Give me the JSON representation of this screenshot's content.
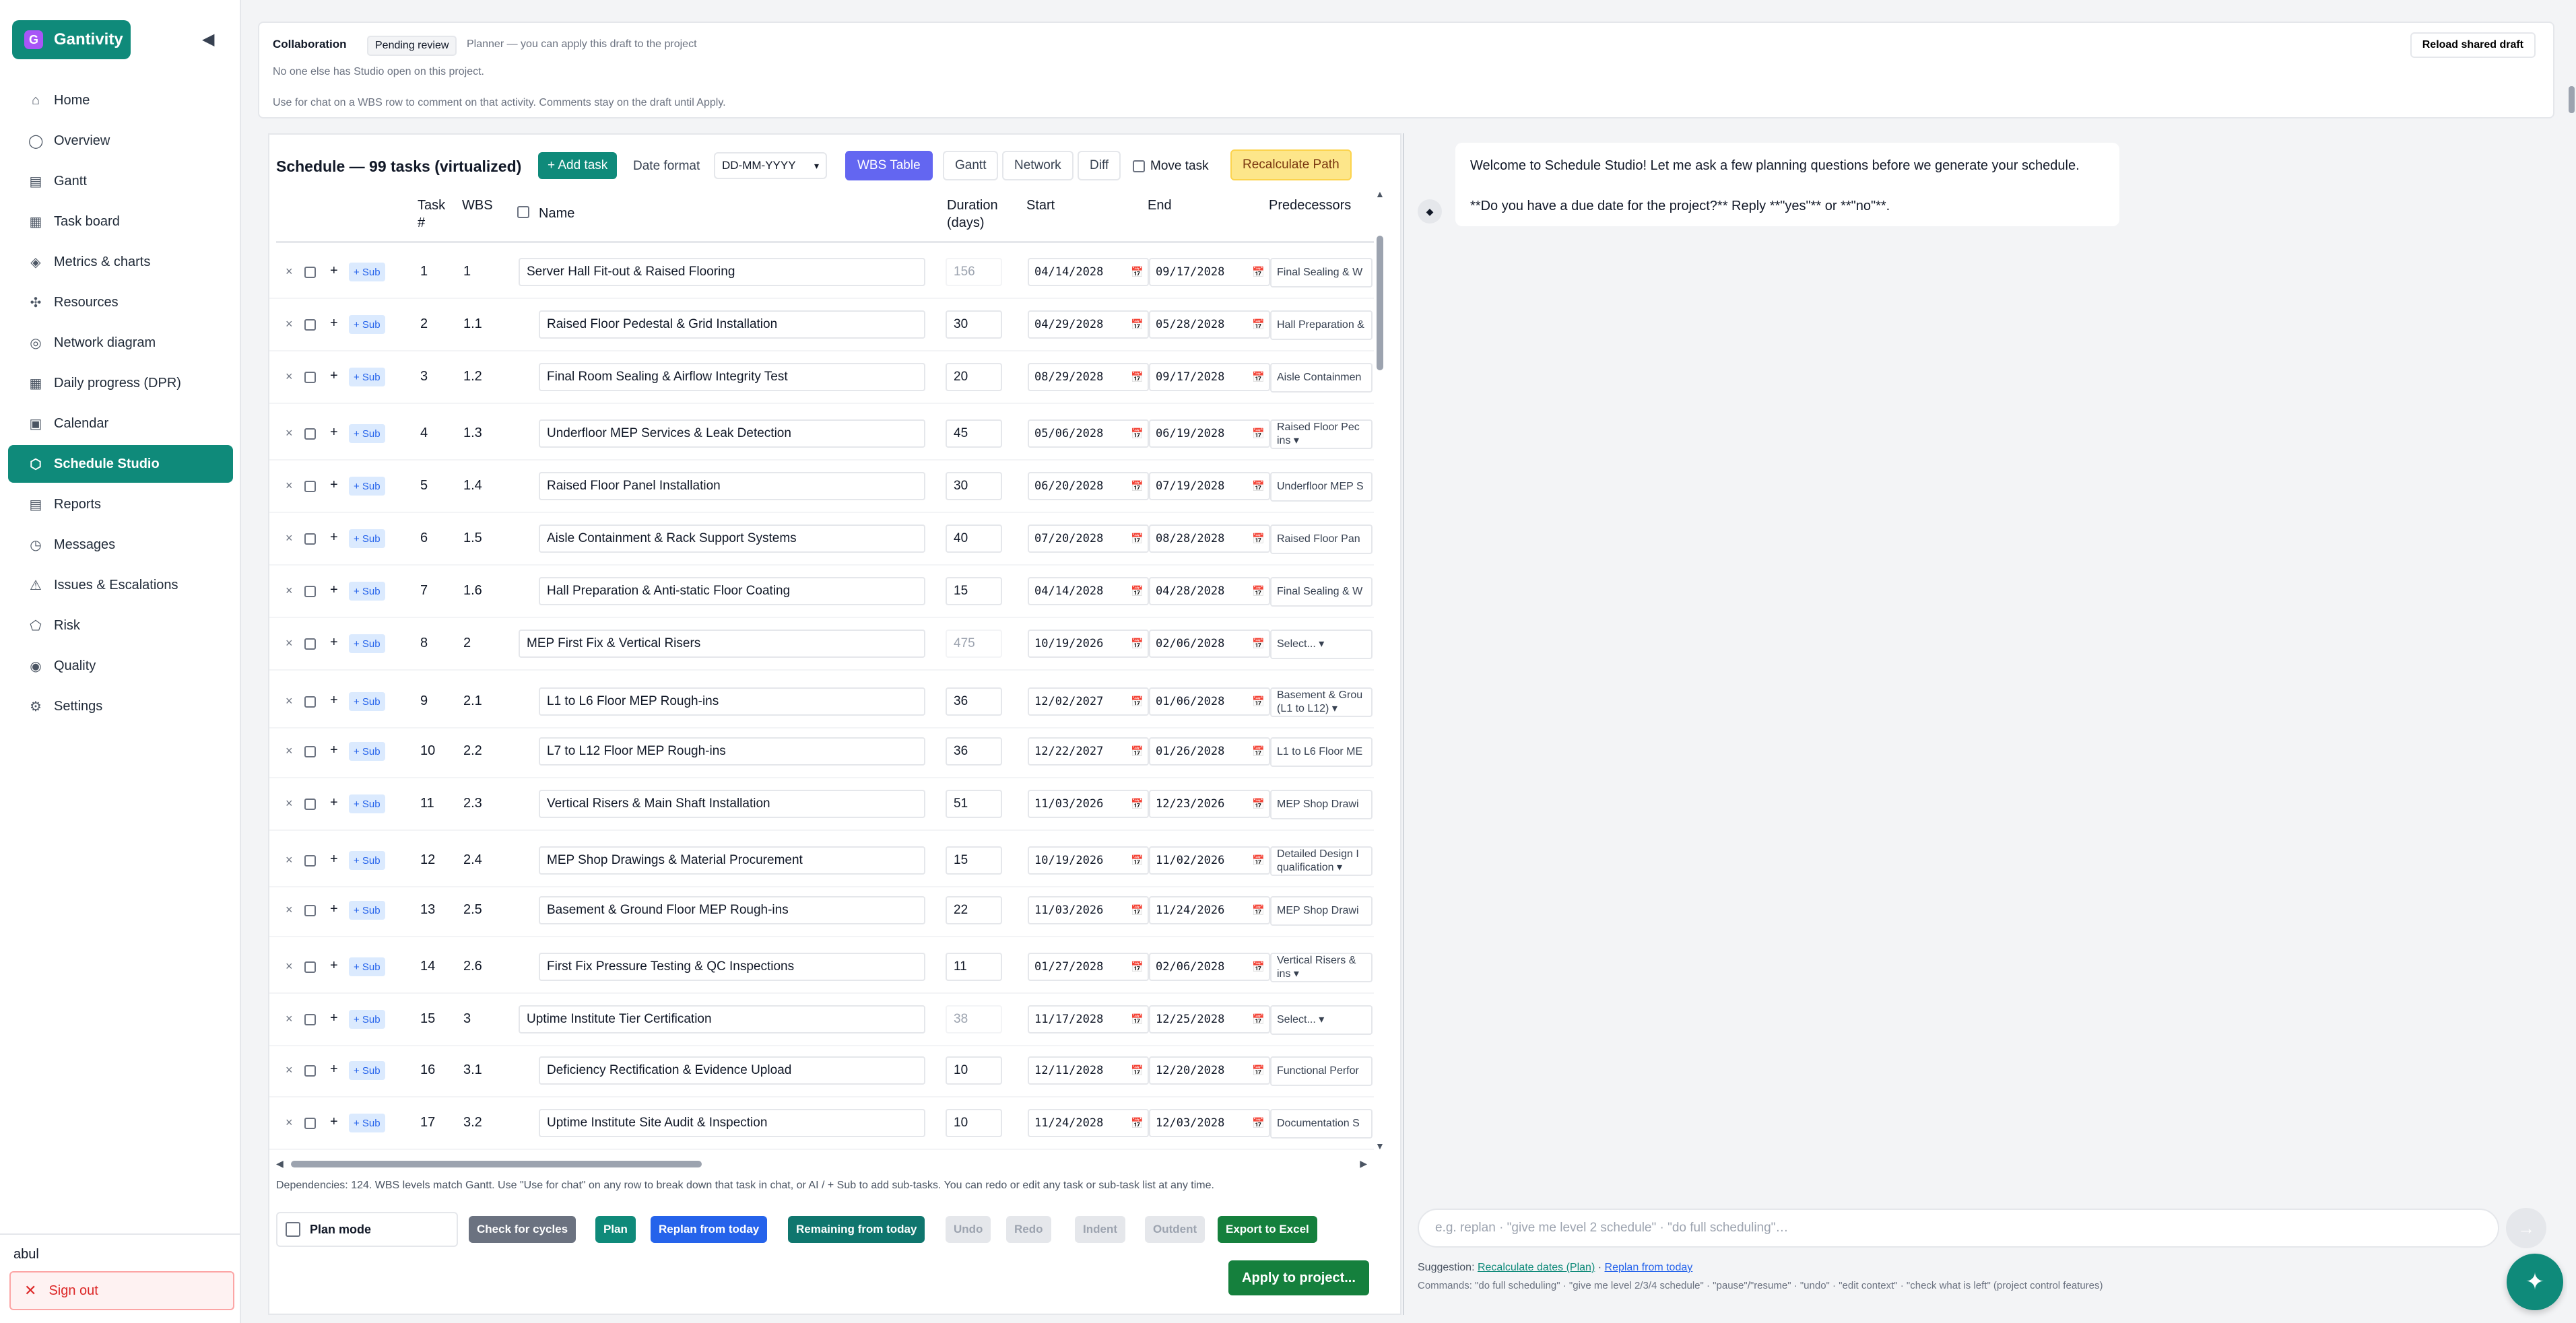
{
  "app": {
    "name": "Gantivity",
    "logo_glyph": "G",
    "collapse_glyph": "◀"
  },
  "sidebar": {
    "items": [
      {
        "label": "Home",
        "icon": "⌂"
      },
      {
        "label": "Overview",
        "icon": "◯"
      },
      {
        "label": "Gantt",
        "icon": "▤"
      },
      {
        "label": "Task board",
        "icon": "▦"
      },
      {
        "label": "Metrics & charts",
        "icon": "◈"
      },
      {
        "label": "Resources",
        "icon": "✣"
      },
      {
        "label": "Network diagram",
        "icon": "◎"
      },
      {
        "label": "Daily progress (DPR)",
        "icon": "▦"
      },
      {
        "label": "Calendar",
        "icon": "▣"
      },
      {
        "label": "Schedule Studio",
        "icon": "⬡"
      },
      {
        "label": "Reports",
        "icon": "▤"
      },
      {
        "label": "Messages",
        "icon": "◷"
      },
      {
        "label": "Issues & Escalations",
        "icon": "⚠"
      },
      {
        "label": "Risk",
        "icon": "⬠"
      },
      {
        "label": "Quality",
        "icon": "◉"
      },
      {
        "label": "Settings",
        "icon": "⚙"
      }
    ],
    "active_index": 9,
    "user": "abul",
    "sign_out": "Sign out",
    "sign_out_icon": "✕"
  },
  "collab": {
    "title": "Collaboration",
    "badge": "Pending review",
    "role": "Planner — you can apply this draft to the project",
    "presence": "No one else has Studio open on this project.",
    "hint": "Use for chat on a WBS row to comment on that activity. Comments stay on the draft until Apply.",
    "reload": "Reload shared draft"
  },
  "schedule": {
    "title": "Schedule — 99 tasks (virtualized)",
    "add_task": "+ Add task",
    "date_format_label": "Date format",
    "date_format_value": "DD-MM-YYYY",
    "tabs": [
      "WBS Table",
      "Gantt",
      "Network",
      "Diff"
    ],
    "active_tab": 0,
    "move_task": "Move task",
    "recalc": "Recalculate Path",
    "headers": {
      "task_line1": "Task",
      "task_line2": "#",
      "wbs": "WBS",
      "name": "Name",
      "duration_line1": "Duration",
      "duration_line2": "(days)",
      "start": "Start",
      "end": "End",
      "predecessors": "Predecessors"
    },
    "row_controls": {
      "delete": "×",
      "add": "+",
      "sub": "+ Sub",
      "calendar_icon": "📅"
    },
    "rows": [
      {
        "num": "1",
        "wbs": "1",
        "level": 1,
        "name": "Server Hall Fit-out & Raised Flooring",
        "duration": "156",
        "duration_readonly": true,
        "start": "04/14/2028",
        "end": "09/17/2028",
        "pred": "Final Sealing & W"
      },
      {
        "num": "2",
        "wbs": "1.1",
        "level": 2,
        "name": "Raised Floor Pedestal & Grid Installation",
        "duration": "30",
        "duration_readonly": false,
        "start": "04/29/2028",
        "end": "05/28/2028",
        "pred": "Hall Preparation &"
      },
      {
        "num": "3",
        "wbs": "1.2",
        "level": 2,
        "name": "Final Room Sealing & Airflow Integrity Test",
        "duration": "20",
        "duration_readonly": false,
        "start": "08/29/2028",
        "end": "09/17/2028",
        "pred": "Aisle Containmen"
      },
      {
        "num": "4",
        "wbs": "1.3",
        "level": 2,
        "name": "Underfloor MEP Services & Leak Detection",
        "duration": "45",
        "duration_readonly": false,
        "start": "05/06/2028",
        "end": "06/19/2028",
        "pred": "Raised Floor Pec ins ▾"
      },
      {
        "num": "5",
        "wbs": "1.4",
        "level": 2,
        "name": "Raised Floor Panel Installation",
        "duration": "30",
        "duration_readonly": false,
        "start": "06/20/2028",
        "end": "07/19/2028",
        "pred": "Underfloor MEP S"
      },
      {
        "num": "6",
        "wbs": "1.5",
        "level": 2,
        "name": "Aisle Containment & Rack Support Systems",
        "duration": "40",
        "duration_readonly": false,
        "start": "07/20/2028",
        "end": "08/28/2028",
        "pred": "Raised Floor Pan"
      },
      {
        "num": "7",
        "wbs": "1.6",
        "level": 2,
        "name": "Hall Preparation & Anti-static Floor Coating",
        "duration": "15",
        "duration_readonly": false,
        "start": "04/14/2028",
        "end": "04/28/2028",
        "pred": "Final Sealing & W"
      },
      {
        "num": "8",
        "wbs": "2",
        "level": 1,
        "name": "MEP First Fix & Vertical Risers",
        "duration": "475",
        "duration_readonly": true,
        "start": "10/19/2026",
        "end": "02/06/2028",
        "pred": "Select... ▾"
      },
      {
        "num": "9",
        "wbs": "2.1",
        "level": 2,
        "name": "L1 to L6 Floor MEP Rough-ins",
        "duration": "36",
        "duration_readonly": false,
        "start": "12/02/2027",
        "end": "01/06/2028",
        "pred": "Basement & Grou (L1 to L12) ▾"
      },
      {
        "num": "10",
        "wbs": "2.2",
        "level": 2,
        "name": "L7 to L12 Floor MEP Rough-ins",
        "duration": "36",
        "duration_readonly": false,
        "start": "12/22/2027",
        "end": "01/26/2028",
        "pred": "L1 to L6 Floor ME"
      },
      {
        "num": "11",
        "wbs": "2.3",
        "level": 2,
        "name": "Vertical Risers & Main Shaft Installation",
        "duration": "51",
        "duration_readonly": false,
        "start": "11/03/2026",
        "end": "12/23/2026",
        "pred": "MEP Shop Drawi"
      },
      {
        "num": "12",
        "wbs": "2.4",
        "level": 2,
        "name": "MEP Shop Drawings & Material Procurement",
        "duration": "15",
        "duration_readonly": false,
        "start": "10/19/2026",
        "end": "11/02/2026",
        "pred": "Detailed Design I qualification ▾"
      },
      {
        "num": "13",
        "wbs": "2.5",
        "level": 2,
        "name": "Basement & Ground Floor MEP Rough-ins",
        "duration": "22",
        "duration_readonly": false,
        "start": "11/03/2026",
        "end": "11/24/2026",
        "pred": "MEP Shop Drawi"
      },
      {
        "num": "14",
        "wbs": "2.6",
        "level": 2,
        "name": "First Fix Pressure Testing & QC Inspections",
        "duration": "11",
        "duration_readonly": false,
        "start": "01/27/2028",
        "end": "02/06/2028",
        "pred": "Vertical Risers & ins ▾"
      },
      {
        "num": "15",
        "wbs": "3",
        "level": 1,
        "name": "Uptime Institute Tier Certification",
        "duration": "38",
        "duration_readonly": true,
        "start": "11/17/2028",
        "end": "12/25/2028",
        "pred": "Select... ▾"
      },
      {
        "num": "16",
        "wbs": "3.1",
        "level": 2,
        "name": "Deficiency Rectification & Evidence Upload",
        "duration": "10",
        "duration_readonly": false,
        "start": "12/11/2028",
        "end": "12/20/2028",
        "pred": "Functional Perfor"
      },
      {
        "num": "17",
        "wbs": "3.2",
        "level": 2,
        "name": "Uptime Institute Site Audit & Inspection",
        "duration": "10",
        "duration_readonly": false,
        "start": "11/24/2028",
        "end": "12/03/2028",
        "pred": "Documentation S"
      }
    ],
    "deps_note": "Dependencies: 124. WBS levels match Gantt. Use \"Use for chat\" on any row to break down that task in chat, or AI / + Sub to add sub-tasks. You can redo or edit any task or sub-task list at any time.",
    "plan_mode": "Plan mode",
    "buttons": {
      "check_cycles": "Check for cycles",
      "plan": "Plan",
      "replan_today": "Replan from today",
      "remaining_today": "Remaining from today",
      "undo": "Undo",
      "redo": "Redo",
      "indent": "Indent",
      "outdent": "Outdent",
      "export": "Export to Excel"
    },
    "apply": "Apply to project..."
  },
  "chat": {
    "avatar_icon": "◆",
    "message_line1": "Welcome to Schedule Studio! Let me ask a few planning questions before we generate your schedule.",
    "message_line2": "**Do you have a due date for the project?** Reply **\"yes\"** or **\"no\"**.",
    "input_placeholder": "e.g. replan · \"give me level 2 schedule\" · \"do full scheduling\"…",
    "send_icon": "→",
    "suggestion_label": "Suggestion:",
    "suggestion_1": "Recalculate dates (Plan)",
    "suggestion_sep": "·",
    "suggestion_2": "Replan from today",
    "commands": "Commands: \"do full scheduling\" · \"give me level 2/3/4 schedule\" · \"pause\"/\"resume\" · \"undo\" · \"edit context\" · \"check what is left\" (project control features)",
    "fab_icon": "✦"
  },
  "colors": {
    "brand": "#0f8a7a",
    "tab_active": "#6366f1",
    "recalc": "#fde68a",
    "sign_out": "#dc2626"
  }
}
